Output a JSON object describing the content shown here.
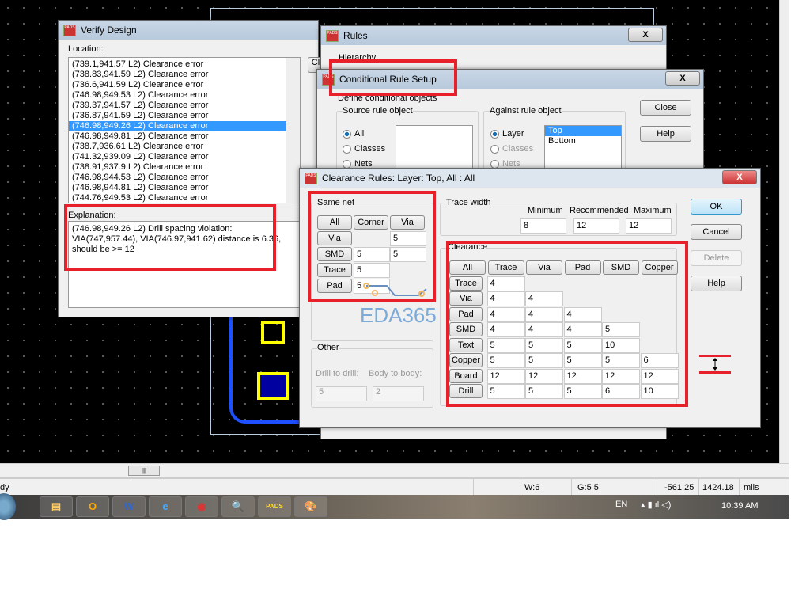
{
  "verify": {
    "title": "Verify Design",
    "location_label": "Location:",
    "items": [
      "(739.1,941.57 L2) Clearance error",
      "(738.83,941.59 L2) Clearance error",
      "(736.6,941.59 L2) Clearance error",
      "(746.98,949.53 L2) Clearance error",
      "(739.37,941.57 L2) Clearance error",
      "(736.87,941.59 L2) Clearance error",
      "(746.98,949.26 L2) Clearance error",
      "(746.98,949.81 L2) Clearance error",
      "(738.7,936.61 L2) Clearance error",
      "(741.32,939.09 L2) Clearance error",
      "(738.91,937.9 L2) Clearance error",
      "(746.98,944.53 L2) Clearance error",
      "(746.98,944.81 L2) Clearance error",
      "(744.76,949.53 L2) Clearance error"
    ],
    "selected_index": 6,
    "explanation_label": "Explanation:",
    "explanation": "(746.98,949.26 L2) Drill spacing violation: VIA(747,957.44), VIA(746.97,941.62) distance is 6.36, should be >= 12",
    "close_label": "Cl"
  },
  "rules": {
    "title": "Rules",
    "hierarchy_label": "Hierarchy",
    "close": "X"
  },
  "conditional": {
    "title": "Conditional Rule Setup",
    "define_label": "Define conditional objects",
    "source_label": "Source rule object",
    "source_options": [
      "All",
      "Classes",
      "Nets"
    ],
    "against_label": "Against rule object",
    "against_options": [
      "Layer",
      "Classes",
      "Nets"
    ],
    "layers": [
      "Top",
      "Bottom"
    ],
    "close_button": "Close",
    "help_button": "Help",
    "close": "X"
  },
  "clearance": {
    "title": "Clearance Rules:  Layer: Top,  All  :  All",
    "close": "X",
    "same_net": {
      "label": "Same net",
      "headers": [
        "All",
        "Corner",
        "Via"
      ],
      "rows": [
        {
          "name": "Via",
          "corner": "",
          "via": "5"
        },
        {
          "name": "SMD",
          "corner": "5",
          "via": "5"
        },
        {
          "name": "Trace",
          "corner": "5",
          "via": ""
        },
        {
          "name": "Pad",
          "corner": "5",
          "via": ""
        }
      ]
    },
    "trace_width": {
      "label": "Trace width",
      "minimum_label": "Minimum",
      "recommended_label": "Recommended",
      "maximum_label": "Maximum",
      "minimum": "8",
      "recommended": "12",
      "maximum": "12"
    },
    "clearance_label": "Clearance",
    "columns": [
      "All",
      "Trace",
      "Via",
      "Pad",
      "SMD",
      "Copper"
    ],
    "rows": [
      {
        "name": "Trace",
        "values": [
          "4"
        ]
      },
      {
        "name": "Via",
        "values": [
          "4",
          "4"
        ]
      },
      {
        "name": "Pad",
        "values": [
          "4",
          "4",
          "4"
        ]
      },
      {
        "name": "SMD",
        "values": [
          "4",
          "4",
          "4",
          "5"
        ]
      },
      {
        "name": "Text",
        "values": [
          "5",
          "5",
          "5",
          "10"
        ]
      },
      {
        "name": "Copper",
        "values": [
          "5",
          "5",
          "5",
          "5",
          "6"
        ]
      },
      {
        "name": "Board",
        "values": [
          "12",
          "12",
          "12",
          "12",
          "12"
        ]
      },
      {
        "name": "Drill",
        "values": [
          "5",
          "5",
          "5",
          "6",
          "10"
        ]
      }
    ],
    "other": {
      "label": "Other",
      "drill_label": "Drill to drill:",
      "body_label": "Body to body:",
      "drill": "5",
      "body": "2"
    },
    "ok": "OK",
    "cancel": "Cancel",
    "delete": "Delete",
    "help": "Help"
  },
  "watermark": "EDA365",
  "statusbar": {
    "ready": "dy",
    "w": "W:6",
    "g": "G:5 5",
    "x": "-561.25",
    "y": "1424.18",
    "units": "mils"
  },
  "taskbar": {
    "lang": "EN",
    "time": "10:39 AM",
    "apps": [
      "Explorer",
      "Outlook",
      "Word",
      "Internet Explorer",
      "Chrome",
      "Search",
      "PADS",
      "Paint"
    ]
  }
}
